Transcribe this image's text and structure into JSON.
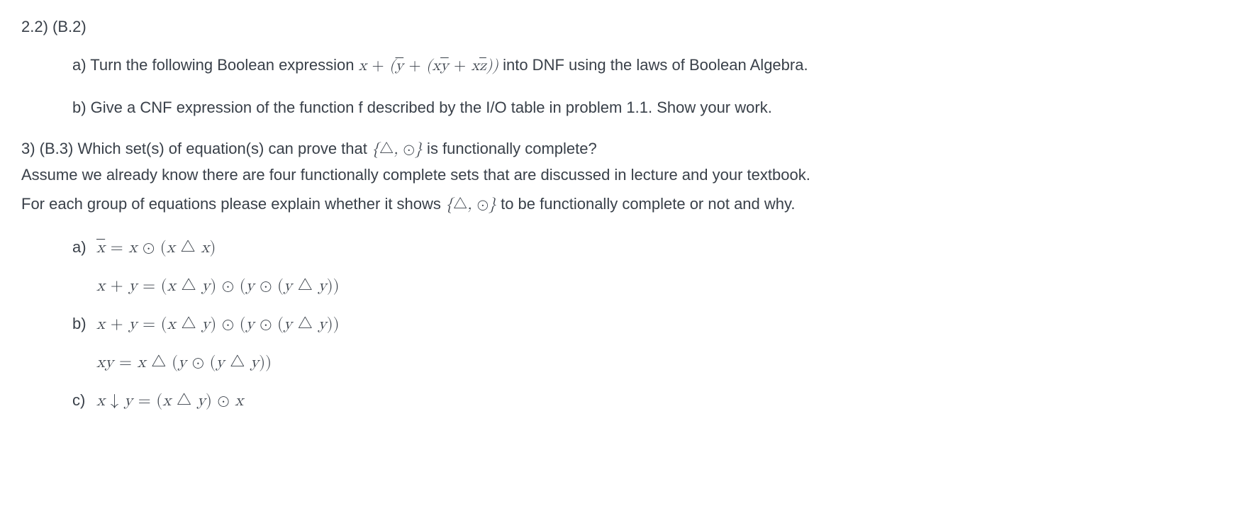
{
  "p22": {
    "number": "2.2) (B.2)",
    "a_prefix": "a) Turn the following Boolean expression ",
    "a_expr_html": "<span class='mathit'>x</span> <span class='op'>+</span> (<span class='mathit bar'>y</span> <span class='op'>+</span> (<span class='mathit'>x</span><span class='mathit bar'>y</span> <span class='op'>+</span> <span class='mathit'>x</span><span class='mathit bar'>z</span>))",
    "a_suffix": " into DNF using the laws of Boolean Algebra.",
    "b": "b) Give a CNF expression of the function f described by the I/O table in problem 1.1. Show your work."
  },
  "p3": {
    "line1_prefix": "3) (B.3) Which set(s) of equation(s) can prove that ",
    "set_html": "{<span class='tri'>△</span>, <span class='odot'>⊙</span>}",
    "line1_suffix": " is functionally complete?",
    "line2": "Assume we already know there are four functionally complete sets that are discussed in lecture and your textbook.",
    "line3_prefix": "For each group of equations please explain whether it shows ",
    "line3_suffix": " to be functionally complete or not and why."
  },
  "eqns": {
    "a": {
      "label": "a)",
      "l1": "<span class='mathit bar'>x</span> <span class='op'>=</span> <span class='mathit'>x</span> <span class='odot'>⊙</span> (<span class='mathit'>x</span> <span class='tri'>△</span> <span class='mathit'>x</span>)",
      "l2": "<span class='mathit'>x</span> <span class='op'>+</span> <span class='mathit'>y</span> <span class='op'>=</span> (<span class='mathit'>x</span> <span class='tri'>△</span> <span class='mathit'>y</span>) <span class='odot'>⊙</span> (<span class='mathit'>y</span> <span class='odot'>⊙</span> (<span class='mathit'>y</span> <span class='tri'>△</span> <span class='mathit'>y</span>))"
    },
    "b": {
      "label": "b)",
      "l1": "<span class='mathit'>x</span> <span class='op'>+</span> <span class='mathit'>y</span> <span class='op'>=</span> (<span class='mathit'>x</span> <span class='tri'>△</span> <span class='mathit'>y</span>) <span class='odot'>⊙</span> (<span class='mathit'>y</span> <span class='odot'>⊙</span> (<span class='mathit'>y</span> <span class='tri'>△</span> <span class='mathit'>y</span>))",
      "l2": "<span class='mathit'>x</span><span class='mathit'>y</span> <span class='op'>=</span> <span class='mathit'>x</span> <span class='tri'>△</span> (<span class='mathit'>y</span> <span class='odot'>⊙</span> (<span class='mathit'>y</span> <span class='tri'>△</span> <span class='mathit'>y</span>))"
    },
    "c": {
      "label": "c)",
      "l1": "<span class='mathit'>x</span> <span class='op'>↓</span> <span class='mathit'>y</span> <span class='op'>=</span> (<span class='mathit'>x</span> <span class='tri'>△</span> <span class='mathit'>y</span>) <span class='odot'>⊙</span> <span class='mathit'>x</span>"
    }
  }
}
